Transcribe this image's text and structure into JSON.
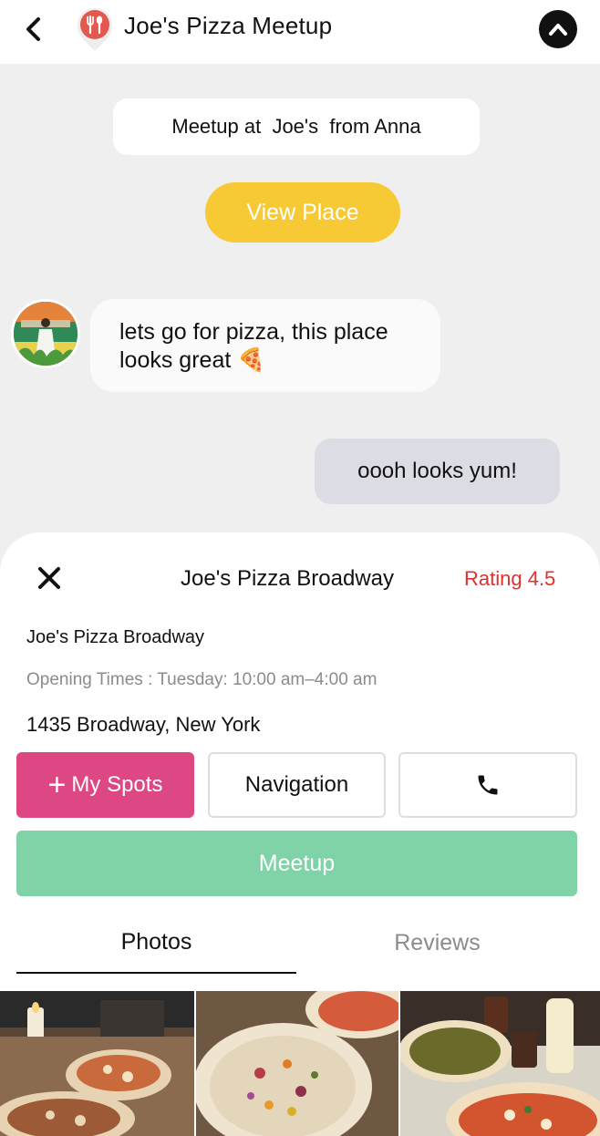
{
  "header": {
    "title": "Joe's Pizza Meetup",
    "back_icon": "chevron-left-icon",
    "place_icon": "restaurant-pin-icon",
    "collapse_icon": "chevron-up-circle-icon"
  },
  "chat": {
    "banner_text": "Meetup at  Joe's  from Anna",
    "view_place_label": "View Place",
    "incoming_message": "lets go for pizza, this place looks great 🍕",
    "outgoing_message": "oooh looks yum!"
  },
  "sheet": {
    "title": "Joe's Pizza Broadway",
    "rating": "Rating 4.5",
    "place_name": "Joe's Pizza Broadway",
    "opening_times": "Opening Times : Tuesday: 10:00 am–4:00 am",
    "address": "1435 Broadway, New York",
    "my_spots_label": "My Spots",
    "navigation_label": "Navigation",
    "call_icon": "phone-icon",
    "meetup_label": "Meetup",
    "tabs": [
      {
        "label": "Photos",
        "active": true
      },
      {
        "label": "Reviews",
        "active": false
      }
    ]
  },
  "colors": {
    "accent_yellow": "#f6c935",
    "my_spots_pink": "#dd4783",
    "meetup_green": "#7fd3a7",
    "rating_red": "#e0312c",
    "pin_red": "#e4594d"
  }
}
